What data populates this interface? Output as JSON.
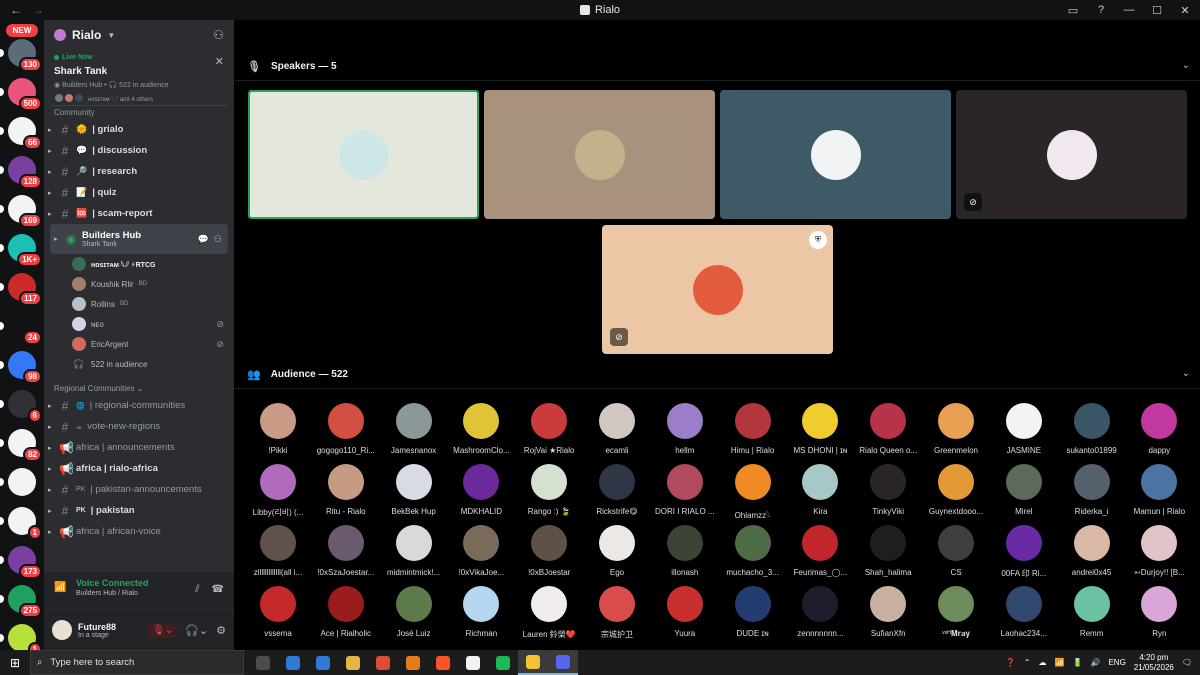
{
  "window": {
    "title": "Rialo",
    "back": "←",
    "forward": "→"
  },
  "rail": {
    "new_label": "NEW",
    "servers": [
      {
        "badge": "130",
        "color": "#5b6b7a"
      },
      {
        "badge": "500",
        "color": "#e9557a"
      },
      {
        "badge": "66",
        "color": "#f2f3f5"
      },
      {
        "badge": "128",
        "color": "#7a3fa0"
      },
      {
        "badge": "169",
        "color": "#f2f3f5"
      },
      {
        "badge": "1K+",
        "color": "#1bbfb6"
      },
      {
        "badge": "117",
        "color": "#cc2a2a"
      },
      {
        "badge": "24",
        "color": "#111214"
      },
      {
        "badge": "98",
        "color": "#3478f6"
      },
      {
        "badge": "6",
        "color": "#2f3136"
      },
      {
        "badge": "82",
        "color": "#f2f3f5"
      },
      {
        "badge": "",
        "color": "#f2f3f5"
      },
      {
        "badge": "1",
        "color": "#f2f3f5"
      },
      {
        "badge": "173",
        "color": "#7a3fa0"
      },
      {
        "badge": "275",
        "color": "#20a060"
      },
      {
        "badge": "1",
        "color": "#b6e03a"
      }
    ]
  },
  "sidebar": {
    "server_name": "Rialo",
    "live": {
      "badge": "Live Now",
      "title": "Shark Tank",
      "sub_channel": "Builders Hub",
      "sub_audience": "522 in audience",
      "people": "ʜᴏsɪᴛᴀᴍ 𓆩𓆪 and 4 others"
    },
    "category_community": "Community",
    "channels": [
      {
        "emoji": "🌞",
        "name": "| grialo"
      },
      {
        "emoji": "💬",
        "name": "| discussion"
      },
      {
        "emoji": "🔎",
        "name": "| research"
      },
      {
        "emoji": "📝",
        "name": "| quiz"
      },
      {
        "emoji": "🆘",
        "name": "| scam-report"
      }
    ],
    "stage": {
      "name": "Builders Hub",
      "topic": "Shark Tank"
    },
    "members": [
      {
        "name": "ʜᴏsɪᴛᴀᴍ 𓆩𓆪 ⚡RTCG",
        "tag": "",
        "muted": false
      },
      {
        "name": "Koushik Ɍlir",
        "tag": "BD",
        "muted": false
      },
      {
        "name": "Rollins",
        "tag": "BD",
        "muted": false
      },
      {
        "name": "ɴᴇᴏ",
        "tag": "",
        "muted": true
      },
      {
        "name": "EricArgent",
        "tag": "",
        "muted": true
      }
    ],
    "audience_line": "522 in audience",
    "category_regional": "Regional Communities",
    "regional": [
      {
        "emoji": "🌐",
        "name": "| regional-communities",
        "bold": false
      },
      {
        "emoji": "☕",
        "name": "vote-new-regions",
        "bold": false
      },
      {
        "emoji": "",
        "name": "africa | announcements",
        "bold": false
      },
      {
        "emoji": "",
        "name": "africa | rialo-africa",
        "bold": true
      },
      {
        "emoji": "PK",
        "name": "| pakistan-announcements",
        "bold": false
      },
      {
        "emoji": "PK",
        "name": "| pakistan",
        "bold": true
      },
      {
        "emoji": "",
        "name": "africa | african-voice",
        "bold": false
      }
    ],
    "voice": {
      "status": "Voice Connected",
      "where": "Builders Hub / Rialo"
    },
    "user": {
      "name": "Future88",
      "status": "In a stage"
    }
  },
  "stage": {
    "speakers_label": "Speakers — 5",
    "audience_label": "Audience — 522",
    "speakers": [
      {
        "bg": "#e4e8dc",
        "av": "#cfe6e8",
        "active": true,
        "muted": false,
        "mod": false
      },
      {
        "bg": "#a8917d",
        "av": "#c4b08a",
        "active": false,
        "muted": false,
        "mod": false
      },
      {
        "bg": "#3e5a67",
        "av": "#f2f3f5",
        "active": false,
        "muted": false,
        "mod": false
      },
      {
        "bg": "#2a2527",
        "av": "#f1e7f0",
        "active": false,
        "muted": true,
        "mod": false
      },
      {
        "bg": "#edc7a5",
        "av": "#e45c3e",
        "active": false,
        "muted": true,
        "mod": true
      }
    ],
    "audience": [
      {
        "name": "!Pikki",
        "c": "#c99a85"
      },
      {
        "name": "gogogo110_Ri...",
        "c": "#d24f43"
      },
      {
        "name": "Jamesnanox",
        "c": "#8b9798"
      },
      {
        "name": "MashroomClo...",
        "c": "#e1c337"
      },
      {
        "name": "RojVai ★Rialo",
        "c": "#cc3b3b"
      },
      {
        "name": "ecamli",
        "c": "#d0c7c2"
      },
      {
        "name": "hellm",
        "c": "#9c7dc9"
      },
      {
        "name": "Himu | Rialo",
        "c": "#b3363f"
      },
      {
        "name": "MS DHONI | ɪɴ",
        "c": "#f0cc2e"
      },
      {
        "name": "Rialo Queen o...",
        "c": "#b8324a"
      },
      {
        "name": "Greenmelon",
        "c": "#e9a052"
      },
      {
        "name": "JASMINE",
        "c": "#f2f3f5"
      },
      {
        "name": "sukanto01899",
        "c": "#3a5566"
      },
      {
        "name": "dappy",
        "c": "#c1389e"
      },
      {
        "name": "Libby(리비) (...",
        "c": "#b06bbd"
      },
      {
        "name": "Ritu - Rialo",
        "c": "#c69b86"
      },
      {
        "name": "BekBek Hup",
        "c": "#d8dbe4"
      },
      {
        "name": "MDKHALID",
        "c": "#6b2a9a"
      },
      {
        "name": "Rango :) 🍃",
        "c": "#d5e0d0"
      },
      {
        "name": "Rickstrife😋",
        "c": "#2f3646"
      },
      {
        "name": "DORI I RIALO ...",
        "c": "#b04a5c"
      },
      {
        "name": "Ohlamzz𓆩",
        "c": "#f08a24"
      },
      {
        "name": "Kira",
        "c": "#a6c8c6"
      },
      {
        "name": "TinkyViki",
        "c": "#2a2626"
      },
      {
        "name": "Guynextdooo...",
        "c": "#e39a35"
      },
      {
        "name": "Mirel",
        "c": "#5b6a5a"
      },
      {
        "name": "Riderka_i",
        "c": "#54606b"
      },
      {
        "name": "Mamun | Rialo",
        "c": "#4b73a3"
      },
      {
        "name": "zlllllllllllll(all i...",
        "c": "#5e524a"
      },
      {
        "name": "!0xSzaJoestar...",
        "c": "#6a5a6e"
      },
      {
        "name": "midmintmick!...",
        "c": "#d9d9d9"
      },
      {
        "name": "!0xVikaJoe...",
        "c": "#7a6a58"
      },
      {
        "name": "!0xBJoestar",
        "c": "#5e5247"
      },
      {
        "name": "Ego",
        "c": "#ece8e6"
      },
      {
        "name": "illonash",
        "c": "#3c4436"
      },
      {
        "name": "muchacho_3...",
        "c": "#4e6b46"
      },
      {
        "name": "Feurimas_◯...",
        "c": "#c1262c"
      },
      {
        "name": "Shah_halima",
        "c": "#1f1f1f"
      },
      {
        "name": "CS",
        "c": "#3e3e3e"
      },
      {
        "name": "00FA 印 Ri...",
        "c": "#6a2aa6"
      },
      {
        "name": "andrei0x45",
        "c": "#d9b8a6"
      },
      {
        "name": "➳Durjoy!! [B...",
        "c": "#e0c4c8"
      },
      {
        "name": "vssema",
        "c": "#c42a2a"
      },
      {
        "name": "Ace | Rialholic",
        "c": "#9a1c1c"
      },
      {
        "name": "José Luiz",
        "c": "#5c7a4a"
      },
      {
        "name": "Richman",
        "c": "#b5d6ef"
      },
      {
        "name": "Lauren 鈴榮❤️",
        "c": "#f1ecec"
      },
      {
        "name": "宗城护卫",
        "c": "#d84c4c"
      },
      {
        "name": "Yuura",
        "c": "#c7302f"
      },
      {
        "name": "DUDE ɪɴ",
        "c": "#233c72"
      },
      {
        "name": "zennnnnnn...",
        "c": "#1e1e2c"
      },
      {
        "name": "SufianXfn",
        "c": "#c8b0a0"
      },
      {
        "name": "ᵛˢᴴ𝐌𝐫𝐚𝐲",
        "c": "#6c8c5a"
      },
      {
        "name": "Laohac234...",
        "c": "#31486e"
      },
      {
        "name": "Remm",
        "c": "#6cc3a4"
      },
      {
        "name": "Ryn",
        "c": "#d9a7d7"
      }
    ]
  },
  "taskbar": {
    "search_placeholder": "Type here to search",
    "lang": "ENG",
    "time": "4:20 pm",
    "date": "21/05/2026",
    "apps": [
      "#4b4b4b",
      "#2f7ad9",
      "#2f7ad9",
      "#e4b542",
      "#dd4b39",
      "#e87a1e",
      "#fb542b",
      "#f2f2f2",
      "#1db954",
      "#f4c430",
      "#5865f2"
    ]
  }
}
